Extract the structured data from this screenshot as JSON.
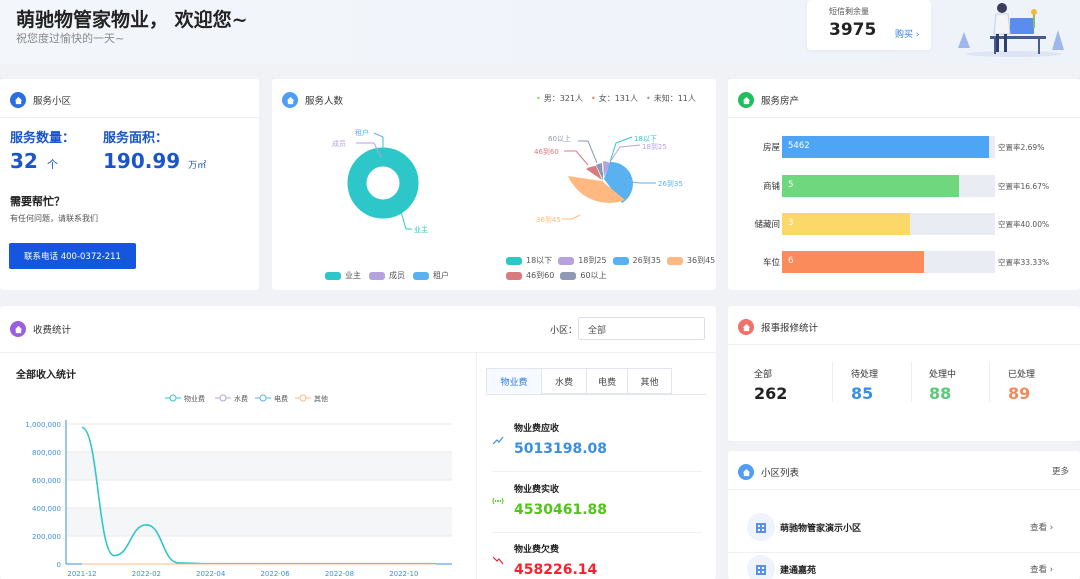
{
  "header": {
    "title": "萌驰物管家物业， 欢迎您~",
    "subtitle": "祝您度过愉快的一天~",
    "sms": {
      "label": "短信剩余量",
      "count": "3975",
      "buy_label": "购买"
    }
  },
  "service_community": {
    "title": "服务小区",
    "count_label": "服务数量：",
    "count_value": "32",
    "count_unit": "个",
    "area_label": "服务面积：",
    "area_value": "190.99",
    "area_unit": "万㎡",
    "help_title": "需要帮忙？",
    "help_text": "有任何问题，请联系我们",
    "contact_button": "联系电话 400-0372-211"
  },
  "service_people": {
    "title": "服务人数",
    "summary": [
      {
        "label": "男：321人",
        "color": "#7fd36b"
      },
      {
        "label": "女：131人",
        "color": "#e8736f"
      },
      {
        "label": "未知：11人",
        "color": "#8a93a6"
      }
    ],
    "pie1": {
      "labels": [
        "业主",
        "成员",
        "租户"
      ],
      "legend": [
        {
          "label": "业主",
          "color": "#2ec7c9"
        },
        {
          "label": "成员",
          "color": "#b6a2de"
        },
        {
          "label": "租户",
          "color": "#5ab1ef"
        }
      ]
    },
    "pie2": {
      "labels": [
        "18以下",
        "18到25",
        "26到35",
        "36到45",
        "46到60",
        "60以上"
      ],
      "legend": [
        {
          "label": "18以下",
          "color": "#2ec7c9"
        },
        {
          "label": "18到25",
          "color": "#b6a2de"
        },
        {
          "label": "26到35",
          "color": "#5ab1ef"
        },
        {
          "label": "36到45",
          "color": "#ffb980"
        },
        {
          "label": "46到60",
          "color": "#d87a80"
        },
        {
          "label": "60以上",
          "color": "#8d98b3"
        }
      ]
    }
  },
  "service_property": {
    "title": "服务房产",
    "rows": [
      {
        "label": "房屋",
        "value": "5462",
        "fill": 0.973,
        "rate": "空置率2.69%",
        "color": "#4fa5f5"
      },
      {
        "label": "商铺",
        "value": "5",
        "fill": 0.833,
        "rate": "空置率16.67%",
        "color": "#6fd87f"
      },
      {
        "label": "储藏间",
        "value": "3",
        "fill": 0.6,
        "rate": "空置率40.00%",
        "color": "#fbd867"
      },
      {
        "label": "车位",
        "value": "6",
        "fill": 0.667,
        "rate": "空置率33.33%",
        "color": "#fb8b5a"
      }
    ]
  },
  "fees": {
    "title": "收费统计",
    "community_label": "小区：",
    "community_select": "全部",
    "chart_title": "全部收入统计",
    "tabs": [
      "物业费",
      "水费",
      "电费",
      "其他"
    ],
    "items": [
      {
        "title": "物业费应收",
        "value": "5013198.08",
        "color": "#3a8ee6",
        "icon": "trend-up-icon"
      },
      {
        "title": "物业费实收",
        "value": "4530461.88",
        "color": "#52c41a",
        "icon": "wifi-signal-icon"
      },
      {
        "title": "物业费欠费",
        "value": "458226.14",
        "color": "#f5222d",
        "icon": "trend-down-icon"
      }
    ]
  },
  "chart_data": {
    "type": "line",
    "title": "全部收入统计",
    "x": [
      "2021-12",
      "2022-01",
      "2022-02",
      "2022-03",
      "2022-04",
      "2022-05",
      "2022-06",
      "2022-07",
      "2022-08",
      "2022-09",
      "2022-10",
      "2022-11"
    ],
    "x_tick_labels": [
      "2021-12",
      "2022-02",
      "2022-04",
      "2022-06",
      "2022-08",
      "2022-10"
    ],
    "ylim": [
      0,
      1000000
    ],
    "y_ticks": [
      "1,000,000",
      "800,000",
      "600,000",
      "400,000",
      "200,000",
      "0"
    ],
    "series": [
      {
        "name": "物业费",
        "color": "#2ec7c9",
        "values": [
          975000,
          60000,
          280000,
          8000,
          2000,
          2000,
          2000,
          2000,
          2000,
          2000,
          2000,
          2000
        ]
      },
      {
        "name": "水费",
        "color": "#b6a2de",
        "values": [
          0,
          0,
          0,
          0,
          0,
          0,
          0,
          0,
          0,
          0,
          0,
          0
        ]
      },
      {
        "name": "电费",
        "color": "#5ab1ef",
        "values": [
          0,
          0,
          0,
          0,
          0,
          0,
          0,
          0,
          0,
          0,
          0,
          0
        ]
      },
      {
        "name": "其他",
        "color": "#ffb980",
        "values": [
          0,
          0,
          0,
          0,
          0,
          0,
          0,
          0,
          0,
          0,
          0,
          0
        ]
      }
    ],
    "grid": true,
    "legend": "top"
  },
  "repairs": {
    "title": "报事报修统计",
    "stats": [
      {
        "label": "全部",
        "value": "262",
        "color": "#222"
      },
      {
        "label": "待处理",
        "value": "85",
        "color": "#3a8ee6"
      },
      {
        "label": "处理中",
        "value": "88",
        "color": "#5cc87a"
      },
      {
        "label": "已处理",
        "value": "89",
        "color": "#f08a5d"
      }
    ]
  },
  "communities": {
    "title": "小区列表",
    "more": "更多",
    "items": [
      {
        "name": "萌驰物管家演示小区",
        "view": "查看"
      },
      {
        "name": "建通嘉苑",
        "view": "查看"
      }
    ]
  }
}
